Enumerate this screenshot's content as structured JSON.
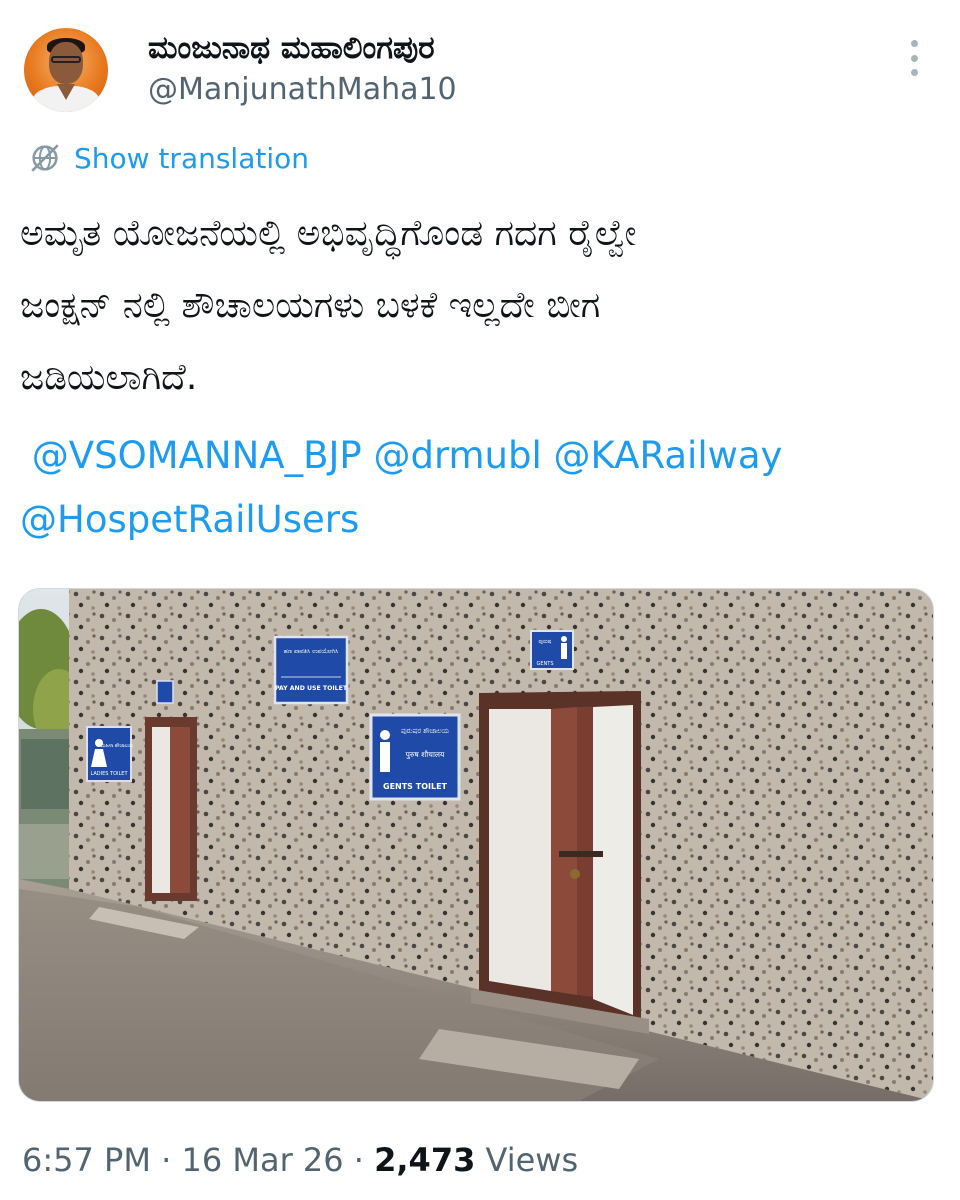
{
  "author": {
    "display_name": "ಮಂಜುನಾಥ ಮಹಾಲಿಂಗಪುರ",
    "handle": "@ManjunathMaha10",
    "avatar_icon": "profile-avatar"
  },
  "translate": {
    "icon": "globe-slash-icon",
    "label": "Show translation"
  },
  "tweet": {
    "lines": [
      "ಅಮೃತ ಯೋಜನೆಯಲ್ಲಿ ಅಭಿವೃದ್ಧಿಗೊಂಡ ಗದಗ ರೈಲ್ವೇ",
      "ಜಂಕ್ಷನ್ ನಲ್ಲಿ ಶೌಚಾಲಯಗಳು ಬಳಕೆ ಇಲ್ಲದೇ  ಬೀಗ",
      "ಜಡಿಯಲಾಗಿದೆ."
    ],
    "mentions": [
      "@VSOMANNA_BJP",
      "@drmubl",
      "@KARailway",
      "@HospetRailUsers"
    ]
  },
  "media": {
    "signs": {
      "ladies": "LADIES TOILET",
      "ladies_kn": "ಮಹಿಳಾ ಶೌಚಾಲಯ",
      "pay": "PAY AND USE TOILET",
      "pay_kn": "ಹಣ ಪಾವತಿಸಿ ಉಪಯೋಗಿಸಿ",
      "gents": "GENTS TOILET",
      "gents_kn": "ಪುರುಷರ ಶೌಚಾಲಯ",
      "gents_hi": "पुरुष शौचालय",
      "gents_small": "GENTS",
      "gents_small_kn": "ಪುರುಷ"
    },
    "colors": {
      "wall": "#bdb3a5",
      "door_frame": "#6b3a2e",
      "door": "#e9e7e2",
      "sign_blue": "#1f4aa8"
    }
  },
  "meta": {
    "time": "6:57 PM",
    "sep1": " · ",
    "date": "16 Mar 26",
    "sep2": " · ",
    "views_count": "2,473",
    "views_label": " Views"
  }
}
